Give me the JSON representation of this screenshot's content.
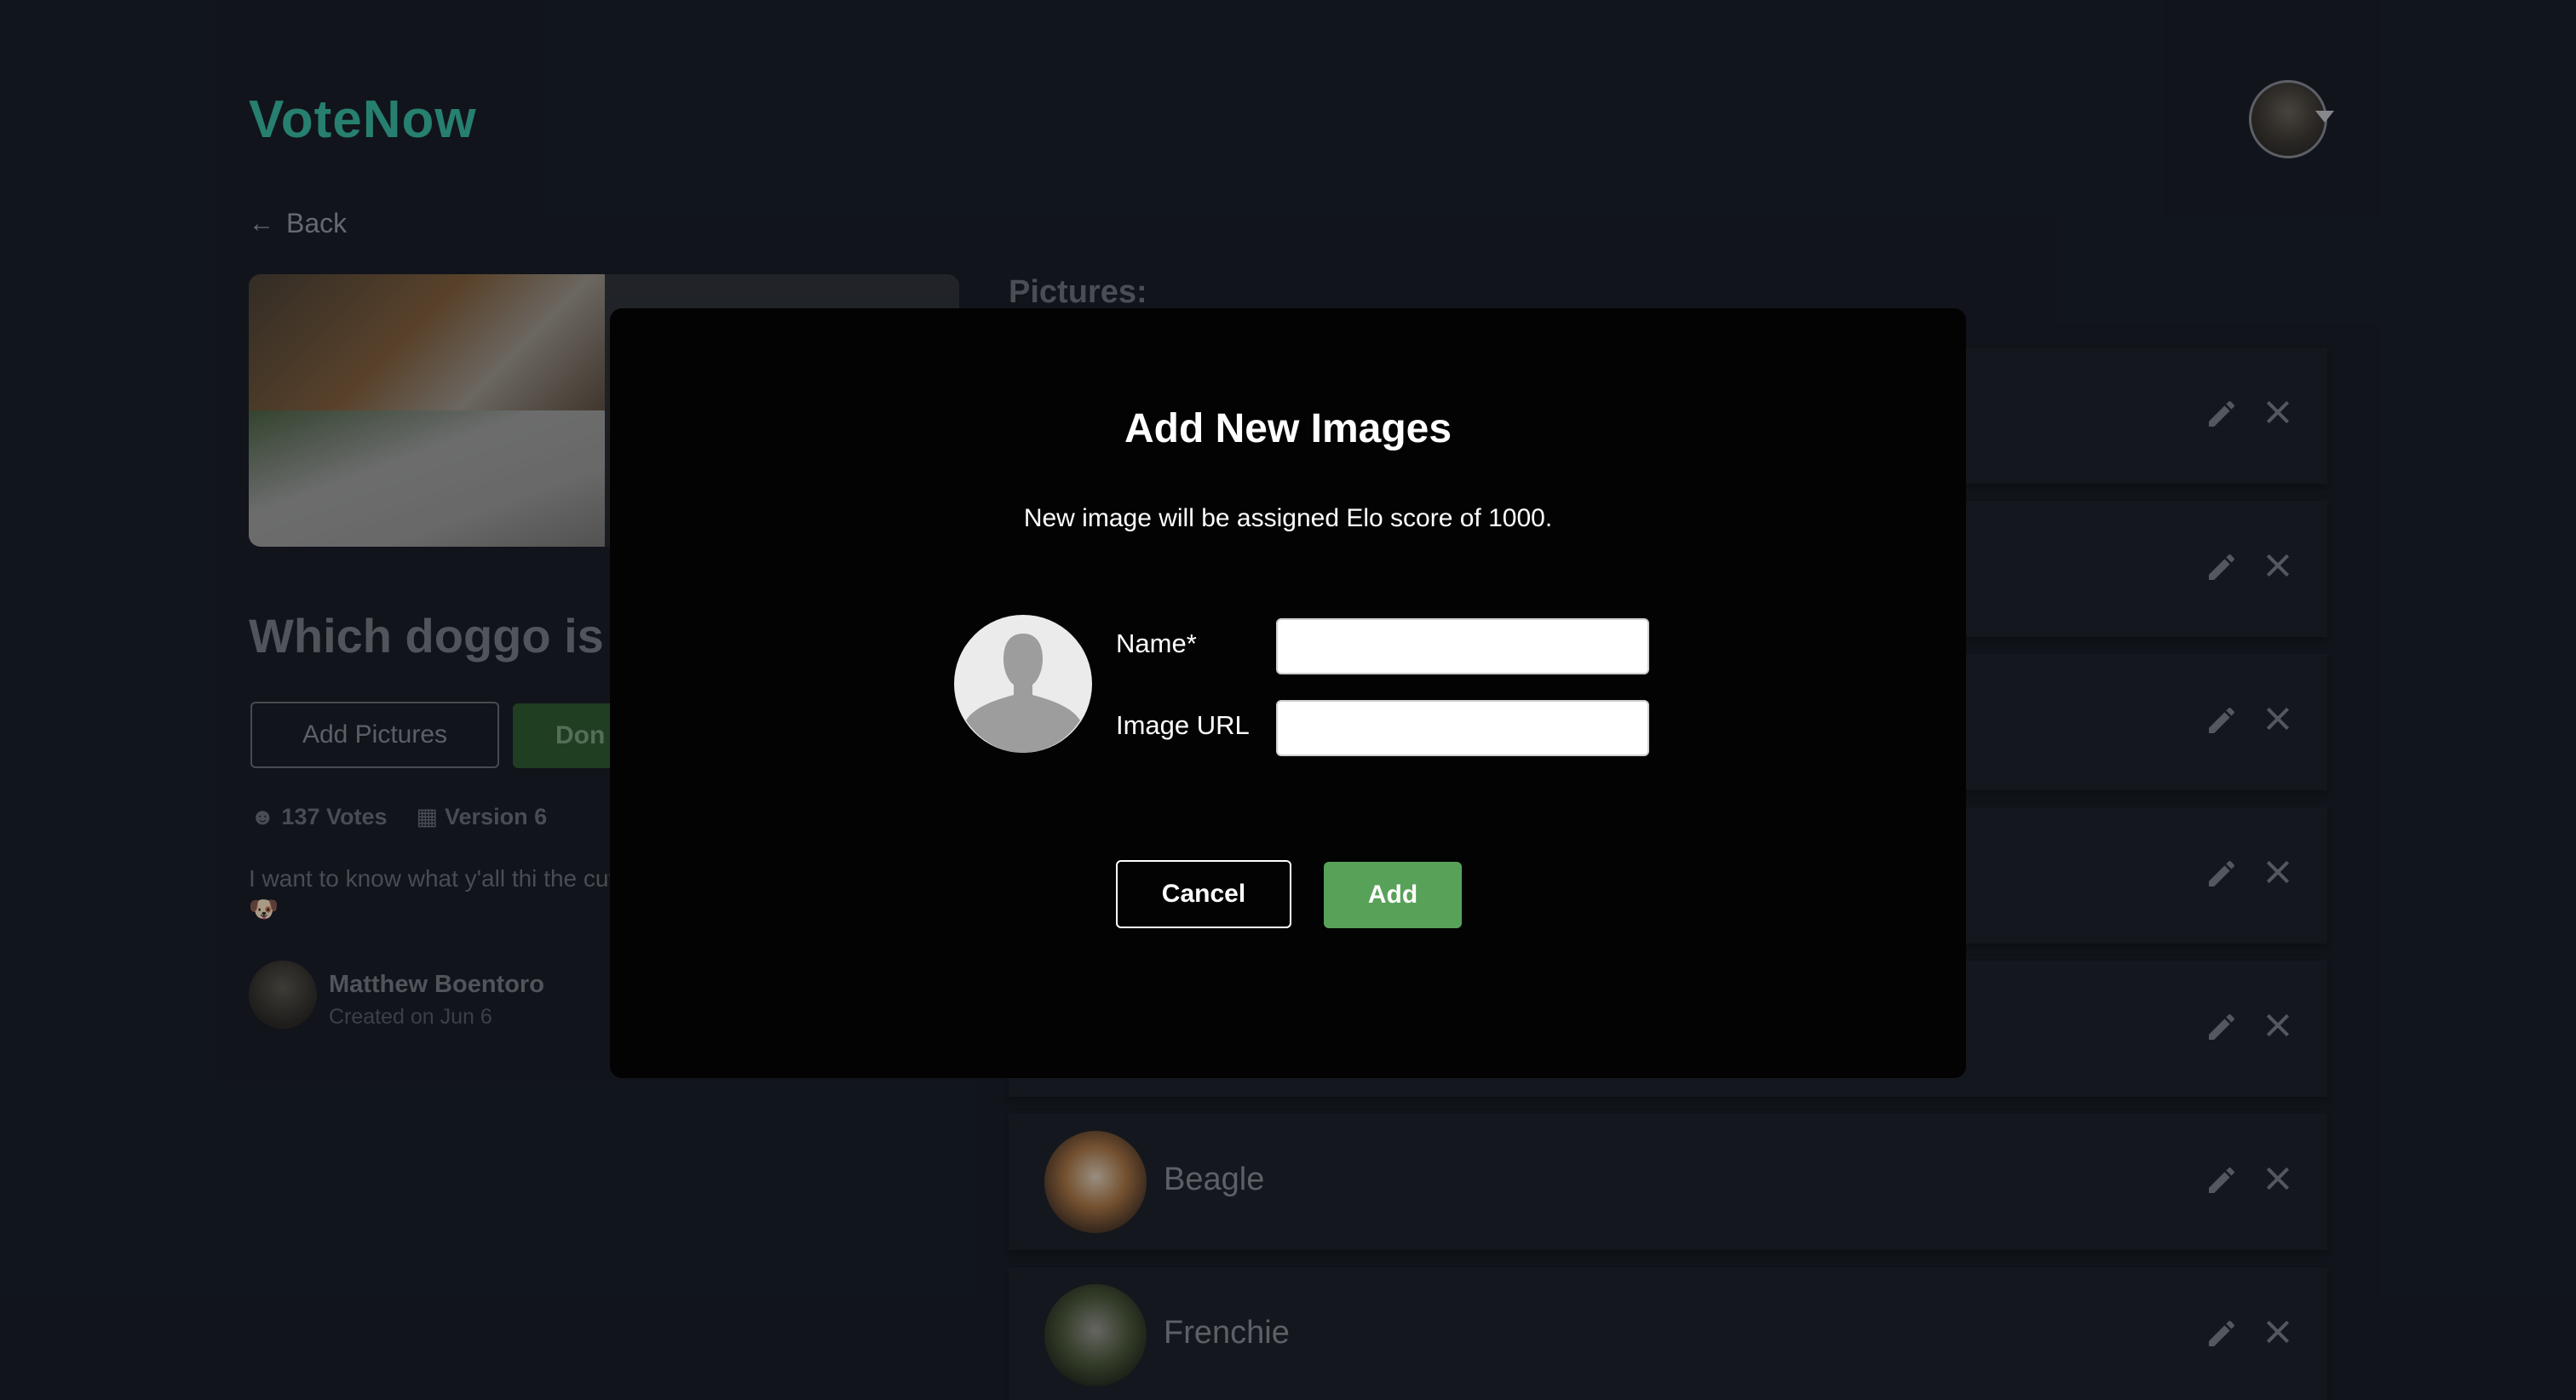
{
  "app": {
    "logo": "VoteNow"
  },
  "nav": {
    "back_label": "Back"
  },
  "poll": {
    "title": "Which doggo is",
    "add_pictures_label": "Add Pictures",
    "done_label": "Don",
    "votes": "137 Votes",
    "version": "Version 6",
    "description": "I want to know what y'all thi the cutest? 🐶",
    "author_name": "Matthew Boentoro",
    "created": "Created on Jun 6"
  },
  "pictures": {
    "heading": "Pictures:",
    "items": [
      {
        "name": ""
      },
      {
        "name": ""
      },
      {
        "name": ""
      },
      {
        "name": ""
      },
      {
        "name": ""
      },
      {
        "name": "Beagle"
      },
      {
        "name": "Frenchie"
      }
    ]
  },
  "modal": {
    "title": "Add New Images",
    "subtitle": "New image will be assigned Elo score of 1000.",
    "name_label": "Name*",
    "name_value": "",
    "url_label": "Image URL",
    "url_value": "",
    "cancel_label": "Cancel",
    "add_label": "Add"
  },
  "colors": {
    "brand": "#39c1a7",
    "add_button": "#58a159",
    "modal_bg": "#030303",
    "page_bg": "#181d25"
  }
}
